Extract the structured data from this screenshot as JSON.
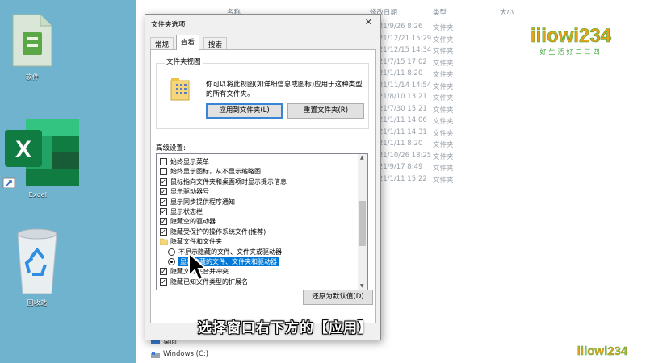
{
  "desktop": {
    "icons": [
      {
        "label": "软件",
        "icon": "folder-zip-icon"
      },
      {
        "label": "Excel",
        "icon": "excel-icon"
      },
      {
        "label": "回收站",
        "icon": "recycle-bin-icon"
      }
    ]
  },
  "explorer": {
    "columns": {
      "name": "名称",
      "date": "修改日期",
      "type": "类型",
      "size": "大小"
    },
    "rows": [
      {
        "date": "2021/9/26 8:26",
        "type": "文件夹"
      },
      {
        "date": "2021/12/21 15:29",
        "type": "文件夹"
      },
      {
        "date": "2021/12/15 14:34",
        "type": "文件夹"
      },
      {
        "date": "2021/7/15 17:02",
        "type": "文件夹"
      },
      {
        "date": "2021/1/11 8:20",
        "type": "文件夹"
      },
      {
        "date": "2021/11/14 14:54",
        "type": "文件夹"
      },
      {
        "date": "2021/8/10 13:21",
        "type": "文件夹"
      },
      {
        "date": "2021/7/30 15:21",
        "type": "文件夹"
      },
      {
        "date": "2021/1/11 14:06",
        "type": "文件夹"
      },
      {
        "date": "2021/1/11 14:31",
        "type": "文件夹"
      },
      {
        "date": "2021/1/11 8:20",
        "type": "文件夹"
      },
      {
        "date": "2021/10/26 18:25",
        "type": "文件夹"
      },
      {
        "date": "2021/9/17 8:49",
        "type": "文件夹"
      },
      {
        "date": "2021/1/11 15:22",
        "type": "文件夹"
      }
    ],
    "nav": {
      "music": "音乐",
      "desktop": "桌面",
      "drive": "Windows (C:)"
    }
  },
  "dialog": {
    "title": "文件夹选项",
    "close": "✕",
    "tabs": [
      "常规",
      "查看",
      "搜索"
    ],
    "active_tab": "查看",
    "folder_view": {
      "legend": "文件夹视图",
      "description": "你可以将此视图(如详细信息或图标)应用于这种类型的所有文件夹。",
      "apply_button": "应用到文件夹(L)",
      "reset_button": "重置文件夹(R)"
    },
    "advanced": {
      "label": "高级设置:",
      "items": [
        {
          "kind": "checkbox",
          "checked": false,
          "text": "始终显示菜单"
        },
        {
          "kind": "checkbox",
          "checked": false,
          "text": "始终显示图标，从不显示缩略图"
        },
        {
          "kind": "checkbox",
          "checked": true,
          "text": "鼠标指向文件夹和桌面项时显示提示信息"
        },
        {
          "kind": "checkbox",
          "checked": true,
          "text": "显示驱动器号"
        },
        {
          "kind": "checkbox",
          "checked": true,
          "text": "显示同步提供程序通知"
        },
        {
          "kind": "checkbox",
          "checked": true,
          "text": "显示状态栏"
        },
        {
          "kind": "checkbox",
          "checked": true,
          "text": "隐藏空的驱动器"
        },
        {
          "kind": "checkbox",
          "checked": true,
          "text": "隐藏受保护的操作系统文件(推荐)"
        },
        {
          "kind": "folder",
          "text": "隐藏文件和文件夹"
        },
        {
          "kind": "radio",
          "checked": false,
          "text": "不显示隐藏的文件、文件夹或驱动器"
        },
        {
          "kind": "radio",
          "checked": true,
          "selected": true,
          "text": "显示隐藏的文件、文件夹和驱动器"
        },
        {
          "kind": "checkbox",
          "checked": true,
          "text": "隐藏文件夹合并冲突"
        },
        {
          "kind": "checkbox",
          "checked": true,
          "text": "隐藏已知文件类型的扩展名"
        }
      ]
    },
    "restore_button": "还原为默认值(D)"
  },
  "caption": "选择窗口右下方的【应用】",
  "brand": {
    "name": "iiiowi234",
    "slogan": "好生活好二三四",
    "accent": "#e8a21a",
    "green": "#3aa635"
  }
}
